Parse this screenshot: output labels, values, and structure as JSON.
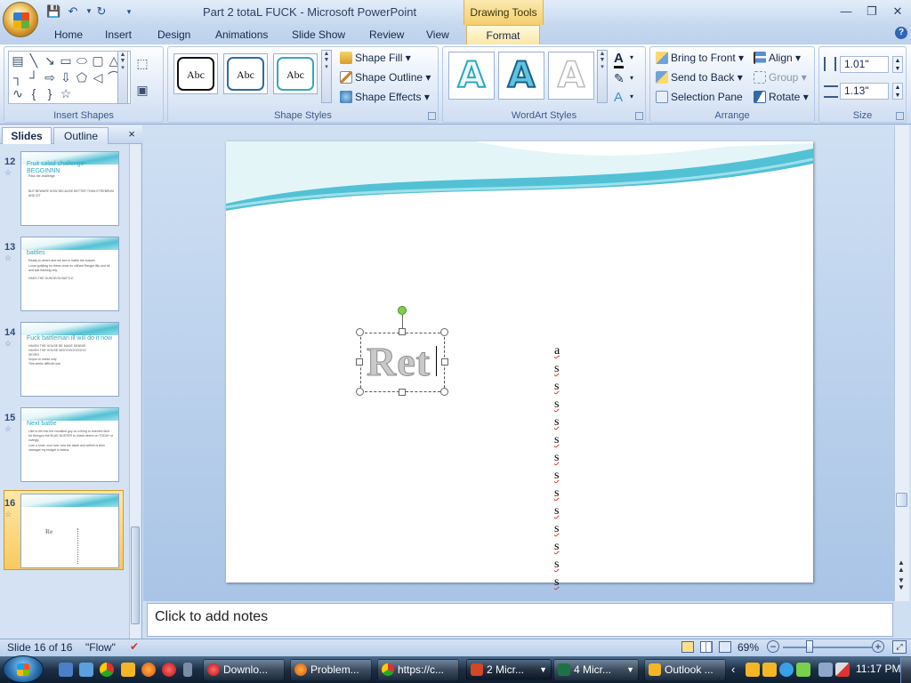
{
  "window": {
    "title": "Part 2 totaL FUCK - Microsoft PowerPoint",
    "context_tab": "Drawing Tools"
  },
  "tabs": [
    "Home",
    "Insert",
    "Design",
    "Animations",
    "Slide Show",
    "Review",
    "View",
    "Format"
  ],
  "ribbon": {
    "insert_shapes_label": "Insert Shapes",
    "shape_styles_label": "Shape Styles",
    "style_samples": [
      "Abc",
      "Abc",
      "Abc"
    ],
    "shape_fill": "Shape Fill",
    "shape_outline": "Shape Outline",
    "shape_effects": "Shape Effects",
    "wordart_label": "WordArt Styles",
    "wordart_samples": [
      "A",
      "A",
      "A"
    ],
    "bring_to_front": "Bring to Front",
    "send_to_back": "Send to Back",
    "selection_pane": "Selection Pane",
    "align": "Align",
    "group": "Group",
    "rotate": "Rotate",
    "arrange_label": "Arrange",
    "size_label": "Size",
    "height": "1.01\"",
    "width": "1.13\""
  },
  "panel": {
    "tab_slides": "Slides",
    "tab_outline": "Outline",
    "close": "×",
    "thumbs": [
      {
        "num": "12",
        "title": "Fruit salad challenge- BEGGINNN",
        "lines": [
          "Pass the challenge",
          "",
          "BUT BEWARE NOW BECAUSE BETTER THAN ETREBRUM AND ZIT"
        ]
      },
      {
        "num": "13",
        "title": "battles",
        "lines": [
          "Ready to where and we see to battle the bosses",
          "Lunar guilding for these done no william Ranger lilly and bil and tale flashing rely.",
          "",
          "HAEN THE DUNGEON BATTLE"
        ]
      },
      {
        "num": "14",
        "title": "Fuck battleman ill will do it now",
        "lines": [
          "HAVEN THE HOUSE BE MADE DENNIS",
          "HAVEN THE HOUSE WOOOOOOOOOO",
          "SEVEN",
          "Doyou to seeke why",
          "This seeks difficult now"
        ]
      },
      {
        "num": "15",
        "title": "Next battle",
        "lines": [
          "Like to fell into the cloudiest guy on a thing to forevent face for thengon the BLUE DUSTER to check where on TODAY or lovingly.",
          "Lure a loner, cool over now the stack and selfish is then manager my budget in status."
        ]
      },
      {
        "num": "16",
        "title": "Re",
        "lines": []
      }
    ]
  },
  "slide": {
    "wordart_text": "Ret",
    "column_chars": [
      "a",
      "s",
      "s",
      "s",
      "s",
      "s",
      "s",
      "s",
      "s",
      "s",
      "s",
      "s",
      "s",
      "s"
    ]
  },
  "notes_placeholder": "Click to add notes",
  "status": {
    "slide_info": "Slide 16 of 16",
    "theme": "\"Flow\"",
    "zoom": "69%"
  },
  "taskbar": {
    "items": [
      "Downlo...",
      "Problem...",
      "https://c...",
      "2 Micr...",
      "4 Micr...",
      "Outlook ..."
    ],
    "time": "11:17 PM"
  },
  "colors": {
    "accent": "#52c1d5",
    "selected_thumb": "#f8ca5f",
    "ribbon_blue": "#15294a"
  }
}
